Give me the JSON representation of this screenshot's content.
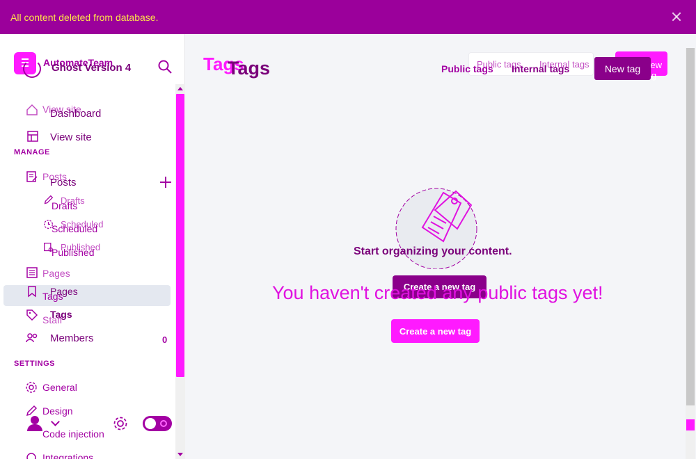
{
  "notification": {
    "message": "All content deleted from database."
  },
  "brand": {
    "name": "AutomateTeam",
    "version": "Ghost Version 4"
  },
  "nav": {
    "view_site_ghost": "View site",
    "dashboard": "Dashboard",
    "view_site": "View site",
    "manage_label": "MANAGE",
    "posts_ghost": "Posts",
    "posts": "Posts",
    "drafts_ghost": "Drafts",
    "drafts": "Drafts",
    "scheduled_ghost": "Scheduled",
    "scheduled": "Scheduled",
    "published_ghost": "Published",
    "published": "Published",
    "pages_ghost": "Pages",
    "pages": "Pages",
    "tags_ghost": "Tags",
    "tags": "Tags",
    "staff_ghost": "Staff",
    "members": "Members",
    "members_count": "0",
    "settings_label": "SETTINGS",
    "general": "General",
    "design": "Design",
    "code_injection": "Code injection",
    "integrations": "Integrations"
  },
  "header": {
    "title_ghost": "Tags",
    "title": "Tags",
    "public_tags_ghost": "Public tags",
    "internal_tags_ghost": "Internal tags",
    "public_tags": "Public tags",
    "internal_tags": "Internal tags",
    "new_tag_ghost": "New tag",
    "new_tag": "New tag"
  },
  "empty_state": {
    "heading": "Start organizing your content.",
    "message": "You haven't created any public tags yet!",
    "create_dark": "Create a new tag",
    "create": "Create a new tag"
  },
  "colors": {
    "accent": "#ff1aff",
    "dark": "#8a008a",
    "banner": "#9b009b"
  }
}
